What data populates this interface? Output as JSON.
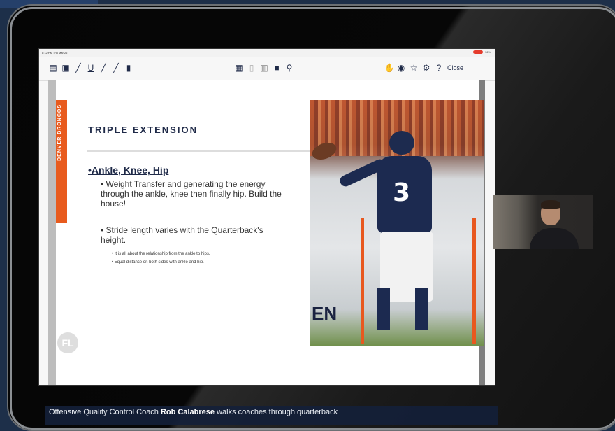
{
  "statusbar": {
    "time": "8:12 PM  Thu Mar 26",
    "battery": "96%"
  },
  "toolbar": {
    "left_icons": [
      "notes-icon",
      "save-icon",
      "pen-icon",
      "underline-icon",
      "marker-icon",
      "pencil-icon",
      "bookmark-icon"
    ],
    "center_icons": [
      "grid-view-icon",
      "single-page-icon",
      "thumbnail-icon",
      "tile-icon",
      "search-icon"
    ],
    "right_icons": [
      "hand-icon",
      "record-icon",
      "star-icon",
      "settings-icon",
      "help-icon"
    ],
    "close_label": "Close"
  },
  "slide": {
    "strip_text": "DENVER BRONCOS",
    "title": "TRIPLE EXTENSION",
    "bullet1": "•Ankle, Knee, Hip",
    "sub1": "• Weight Transfer and generating the energy through the ankle, knee then finally hip. Build the house!",
    "sub2": "• Stride length varies with the Quarterback's height.",
    "detail1": "• It is all about the relationship from the ankle to hips.",
    "detail2": "• Equal distance on both sides with ankle and hip.",
    "photo_text": "EN",
    "jersey_number": "3",
    "badge_text": "FL"
  },
  "caption": {
    "prefix": "Offensive Quality Control Coach ",
    "name": "Rob Calabrese",
    "suffix": " walks coaches through quarterback"
  }
}
